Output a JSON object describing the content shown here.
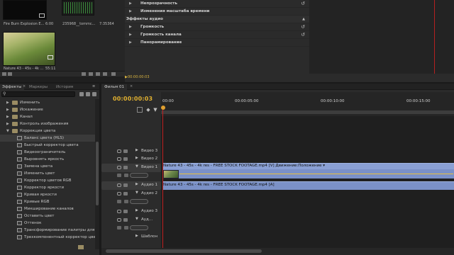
{
  "project": {
    "items": [
      {
        "label": "Fire Burn Explosion E...",
        "duration": "6:00"
      },
      {
        "label": "235968__tommc...",
        "duration": "7:35364"
      },
      {
        "label": "Nature 43 - 45s - 4k ...",
        "duration": "55:11"
      }
    ]
  },
  "effect_controls": {
    "rows": [
      {
        "label": "Непрозрачность",
        "triangle": "▶",
        "reset": true
      },
      {
        "label": "Изменения масштаба времени",
        "triangle": "▶",
        "reset": false
      },
      {
        "label": "Эффекты аудио",
        "triangle": "",
        "reset": false,
        "header": true
      },
      {
        "label": "Громкость",
        "triangle": "▶",
        "reset": true
      },
      {
        "label": "Громкость канала",
        "triangle": "▶",
        "reset": true
      },
      {
        "label": "Панорамирование",
        "triangle": "▶",
        "reset": false
      }
    ],
    "timecode": "00:00:00:03"
  },
  "effects_panel": {
    "tabs": [
      "Эффекты",
      "Маркеры",
      "История"
    ],
    "active_tab": 0,
    "search_placeholder": "",
    "tree": [
      {
        "label": "Изменить",
        "level": 1,
        "type": "folder",
        "expanded": false
      },
      {
        "label": "Искажение",
        "level": 1,
        "type": "folder",
        "expanded": false
      },
      {
        "label": "Канал",
        "level": 1,
        "type": "folder",
        "expanded": false
      },
      {
        "label": "Контроль изображения",
        "level": 1,
        "type": "folder",
        "expanded": false
      },
      {
        "label": "Коррекция цвета",
        "level": 1,
        "type": "folder",
        "expanded": true
      },
      {
        "label": "Баланс цвета (HLS)",
        "level": 2,
        "type": "effect",
        "selected": true
      },
      {
        "label": "Быстрый корректор цвета",
        "level": 2,
        "type": "effect"
      },
      {
        "label": "Видеоограничитель",
        "level": 2,
        "type": "effect"
      },
      {
        "label": "Выровнять яркость",
        "level": 2,
        "type": "effect"
      },
      {
        "label": "Замена цвета",
        "level": 2,
        "type": "effect"
      },
      {
        "label": "Изменить цвет",
        "level": 2,
        "type": "effect"
      },
      {
        "label": "Корректор цветов RGB",
        "level": 2,
        "type": "effect"
      },
      {
        "label": "Корректор яркости",
        "level": 2,
        "type": "effect"
      },
      {
        "label": "Кривая яркости",
        "level": 2,
        "type": "effect"
      },
      {
        "label": "Кривые RGB",
        "level": 2,
        "type": "effect"
      },
      {
        "label": "Микширование каналов",
        "level": 2,
        "type": "effect"
      },
      {
        "label": "Оставить цвет",
        "level": 2,
        "type": "effect"
      },
      {
        "label": "Оттенок",
        "level": 2,
        "type": "effect"
      },
      {
        "label": "Трансформирование палитры для те",
        "level": 2,
        "type": "effect"
      },
      {
        "label": "Трехкомпонентный корректор цвета",
        "level": 2,
        "type": "effect"
      }
    ]
  },
  "timeline": {
    "tab": "Фильм 01",
    "timecode": "00:00:00:03",
    "ruler_labels": [
      "00:00",
      "00:00:05:00",
      "00:00:10:00",
      "00:00:15:00"
    ],
    "tracks": [
      {
        "name": "Видео 3",
        "kind": "video"
      },
      {
        "name": "Видео 2",
        "kind": "video"
      },
      {
        "name": "Видео 1",
        "kind": "video",
        "highlight": true
      },
      {
        "name": "Аудио 1",
        "kind": "audio",
        "highlight": true
      },
      {
        "name": "Аудио 2",
        "kind": "audio"
      },
      {
        "name": "Аудио 3",
        "kind": "audio"
      },
      {
        "name": "Ауд...",
        "kind": "audio"
      },
      {
        "name": "Шаблон",
        "kind": "master"
      }
    ],
    "video_clip": "Nature 43 - 45s - 4k res - FREE STOCK FOOTAGE.mp4 [V]  Движение:Положение ▾",
    "audio_clip": "Nature 43 - 45s - 4k res - FREE STOCK FOOTAGE.mp4 [A]"
  }
}
